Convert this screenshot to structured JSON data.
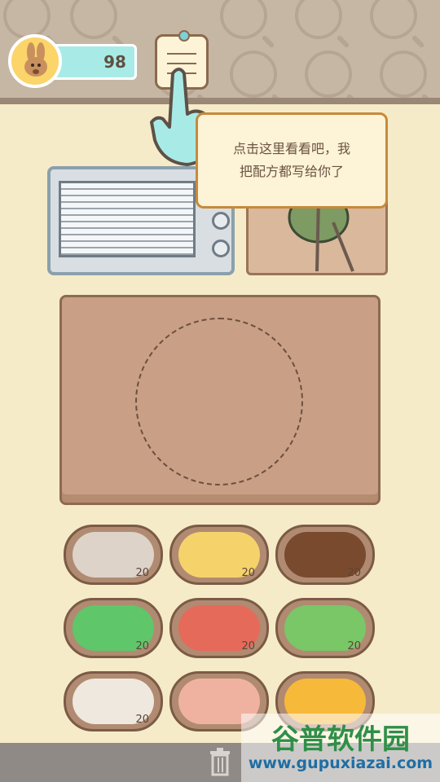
{
  "hud": {
    "coins": "98",
    "avatar_icon": "kangaroo-avatar-icon",
    "recipe_button_icon": "recipe-note-icon"
  },
  "tooltip": {
    "line1": "点击这里看看吧，我",
    "line2": "把配方都写给你了"
  },
  "ingredients": [
    {
      "name": "dough",
      "count": "20"
    },
    {
      "name": "cheese",
      "count": "20"
    },
    {
      "name": "mushrooms-brown",
      "count": "20"
    },
    {
      "name": "lettuce",
      "count": "20"
    },
    {
      "name": "tomato",
      "count": "20"
    },
    {
      "name": "peas",
      "count": "20"
    },
    {
      "name": "mushrooms-white",
      "count": "20"
    },
    {
      "name": "shrimp",
      "count": ""
    },
    {
      "name": "corn",
      "count": ""
    }
  ],
  "watermark": {
    "title": "谷普软件园",
    "url": "www.gupuxiazai.com"
  },
  "colors": {
    "background": "#f6ebc8",
    "coin_bar": "#a8ebe6",
    "tooltip_border": "#c68a3c",
    "counter": "#c9a085"
  }
}
